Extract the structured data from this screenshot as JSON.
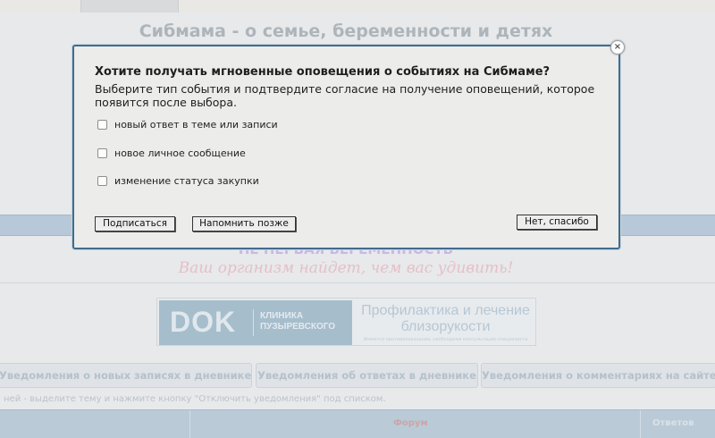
{
  "background": {
    "site_title": "Сибмама - о семье, беременности и детях",
    "promo": {
      "headline": "НЕ ПЕРВАЯ БЕРЕМЕННОСТЬ",
      "subline": "Ваш организм найдет, чем вас удивить!"
    },
    "banner": {
      "logo_text": "DOK",
      "clinic_line1": "КЛИНИКА",
      "clinic_line2": "ПУЗЫРЕВСКОГО",
      "promo_text": "Профилактика и лечение близорукости",
      "promo_small": "Имеются противопоказания, необходима консультация специалиста"
    },
    "tabs": [
      {
        "label": "Уведомления о новых записях в дневнике"
      },
      {
        "label": "Уведомления об ответах в дневнике"
      },
      {
        "label": "Уведомления о комментариях на сайте"
      }
    ],
    "hint": "ней - выделите тему и нажмите кнопку \"Отключить уведомления\" под списком.",
    "table_headers": {
      "topic": "Форум",
      "answers": "Ответов"
    }
  },
  "dialog": {
    "title": "Хотите получать мгновенные оповещения о событиях на Сибмаме?",
    "description": "Выберите тип события и подтвердите согласие на получение оповещений, которое появится после выбора.",
    "options": [
      {
        "label": "новый ответ в теме или записи",
        "checked": false
      },
      {
        "label": "новое личное сообщение",
        "checked": false
      },
      {
        "label": "изменение статуса закупки",
        "checked": false
      }
    ],
    "buttons": {
      "subscribe": "Подписаться",
      "remind_later": "Напомнить позже",
      "no_thanks": "Нет, спасибо"
    },
    "close_icon": "close-icon"
  },
  "colors": {
    "dialog_border": "#3f6d8f",
    "dialog_bg": "#ececea",
    "header_bar": "#aec3d5"
  }
}
